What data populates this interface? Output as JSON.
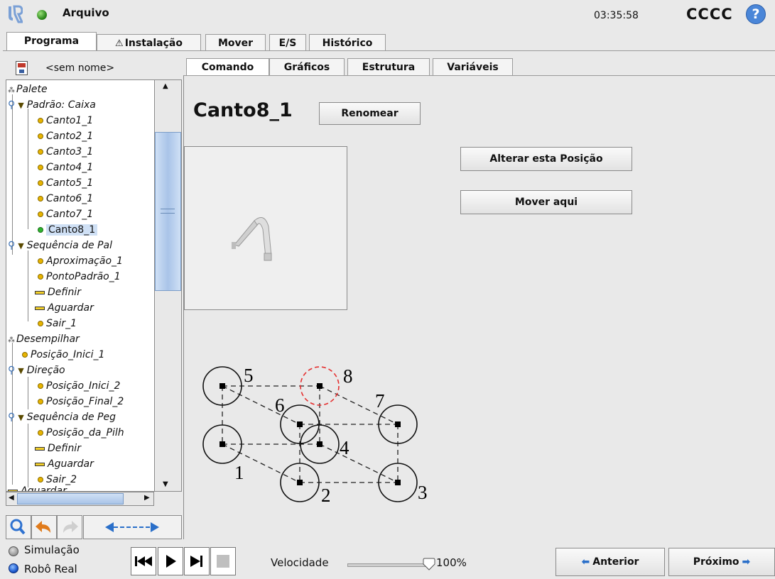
{
  "header": {
    "title": "Arquivo",
    "clock": "03:35:58",
    "robot_name": "CCCC",
    "help": "?"
  },
  "main_tabs": [
    {
      "label": "Programa",
      "active": true
    },
    {
      "label": "Instalação",
      "warning": true
    },
    {
      "label": "Mover"
    },
    {
      "label": "E/S"
    },
    {
      "label": "Histórico"
    }
  ],
  "program": {
    "name": "<sem nome>"
  },
  "tree": [
    {
      "label": "Palete",
      "type": "pallet"
    },
    {
      "label": "Padrão: Caixa",
      "type": "folder"
    },
    {
      "label": "Canto1_1",
      "type": "waypoint"
    },
    {
      "label": "Canto2_1",
      "type": "waypoint"
    },
    {
      "label": "Canto3_1",
      "type": "waypoint"
    },
    {
      "label": "Canto4_1",
      "type": "waypoint"
    },
    {
      "label": "Canto5_1",
      "type": "waypoint"
    },
    {
      "label": "Canto6_1",
      "type": "waypoint"
    },
    {
      "label": "Canto7_1",
      "type": "waypoint"
    },
    {
      "label": "Canto8_1",
      "type": "waypoint",
      "selected": true
    },
    {
      "label": "Sequência de Pal",
      "type": "folder"
    },
    {
      "label": "Aproximação_1",
      "type": "waypoint"
    },
    {
      "label": "PontoPadrão_1",
      "type": "waypoint"
    },
    {
      "label": "Definir",
      "type": "command"
    },
    {
      "label": "Aguardar",
      "type": "command"
    },
    {
      "label": "Sair_1",
      "type": "waypoint"
    },
    {
      "label": "Desempilhar",
      "type": "pallet"
    },
    {
      "label": "Posição_Inici_1",
      "type": "waypoint"
    },
    {
      "label": "Direção",
      "type": "folder"
    },
    {
      "label": "Posição_Inici_2",
      "type": "waypoint"
    },
    {
      "label": "Posição_Final_2",
      "type": "waypoint"
    },
    {
      "label": "Sequência de Peg",
      "type": "folder"
    },
    {
      "label": "Posição_da_Pilh",
      "type": "waypoint"
    },
    {
      "label": "Definir",
      "type": "command"
    },
    {
      "label": "Aguardar",
      "type": "command"
    },
    {
      "label": "Sair_2",
      "type": "waypoint"
    },
    {
      "label": "Aguardar",
      "type": "command"
    }
  ],
  "sub_tabs": [
    {
      "label": "Comando",
      "active": true
    },
    {
      "label": "Gráficos"
    },
    {
      "label": "Estrutura"
    },
    {
      "label": "Variáveis"
    }
  ],
  "command": {
    "node_name": "Canto8_1",
    "rename_label": "Renomear",
    "change_position_label": "Alterar esta Posição",
    "move_here_label": "Mover aqui"
  },
  "diagram_labels": [
    "1",
    "2",
    "3",
    "4",
    "5",
    "6",
    "7",
    "8"
  ],
  "bottom": {
    "simulation_label": "Simulação",
    "real_robot_label": "Robô Real",
    "speed_label": "Velocidade",
    "speed_value": "100%",
    "speed_fraction": 1.0,
    "prev_label": "Anterior",
    "next_label": "Próximo"
  }
}
